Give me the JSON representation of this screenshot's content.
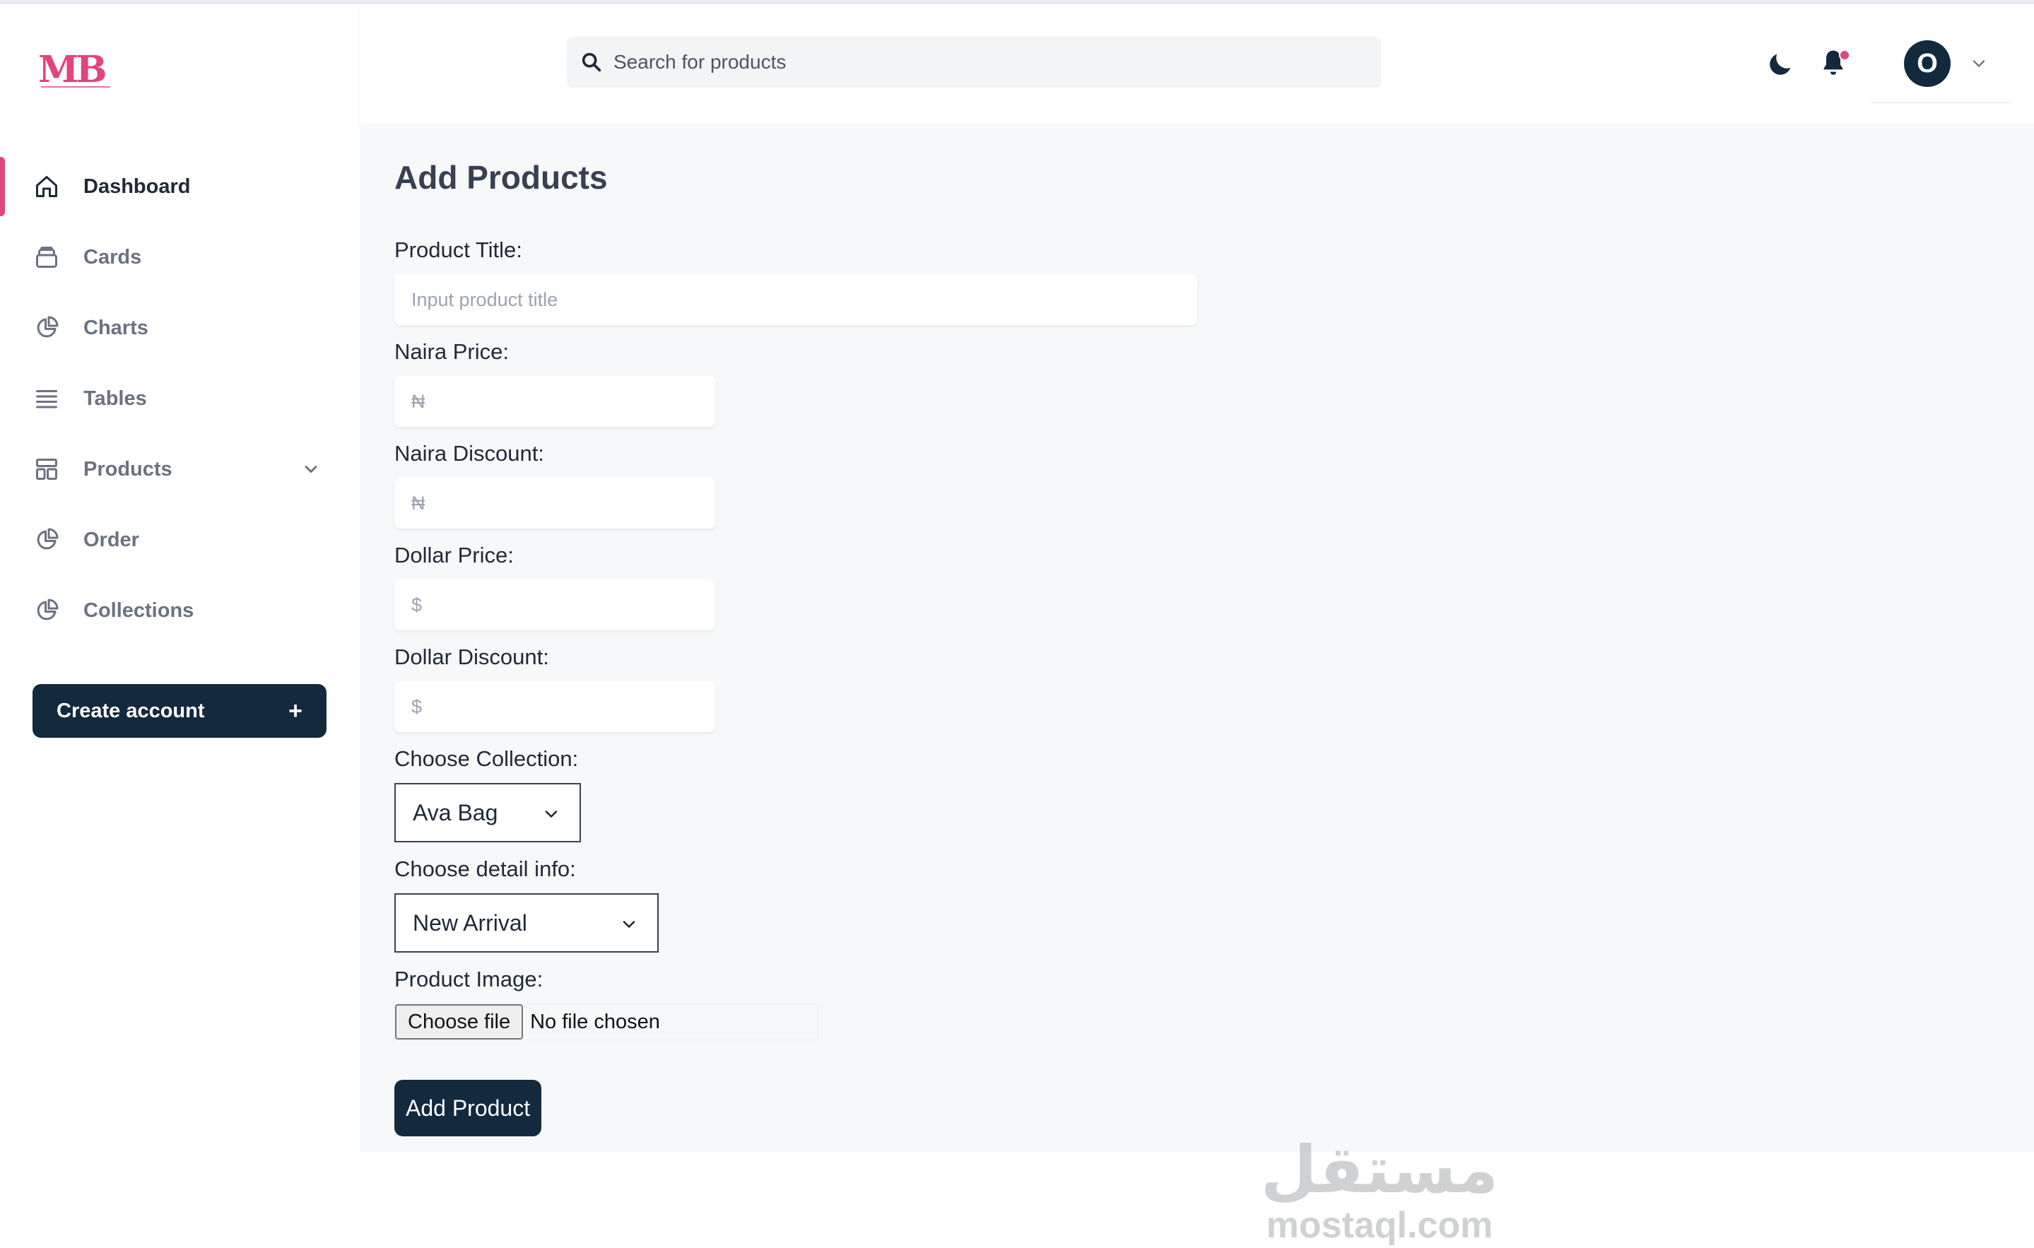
{
  "brand": {
    "logo_text": "MB",
    "accent_color": "#e0457b",
    "dark_color": "#13293d"
  },
  "search": {
    "placeholder": "Search for products"
  },
  "header": {
    "avatar_initial": "O"
  },
  "sidebar": {
    "items": [
      {
        "label": "Dashboard",
        "icon": "home-icon",
        "active": true
      },
      {
        "label": "Cards",
        "icon": "card-stack-icon"
      },
      {
        "label": "Charts",
        "icon": "pie-chart-icon"
      },
      {
        "label": "Tables",
        "icon": "list-icon"
      },
      {
        "label": "Products",
        "icon": "layout-icon",
        "has_submenu": true
      },
      {
        "label": "Order",
        "icon": "pie-chart-icon"
      },
      {
        "label": "Collections",
        "icon": "pie-chart-icon"
      }
    ],
    "create_account_label": "Create account",
    "create_account_icon": "+"
  },
  "form": {
    "title": "Add Products",
    "product_title_label": "Product Title:",
    "product_title_placeholder": "Input product title",
    "naira_price_label": "Naira Price:",
    "naira_price_placeholder": "₦",
    "naira_discount_label": "Naira Discount:",
    "naira_discount_placeholder": "₦",
    "dollar_price_label": "Dollar Price:",
    "dollar_price_placeholder": "$",
    "dollar_discount_label": "Dollar Discount:",
    "dollar_discount_placeholder": "$",
    "collection_label": "Choose Collection:",
    "collection_value": "Ava Bag",
    "detail_label": "Choose detail info:",
    "detail_value": "New Arrival",
    "image_label": "Product Image:",
    "file_button_label": "Choose file",
    "file_status": "No file chosen",
    "submit_label": "Add Product"
  },
  "watermark": {
    "arabic": "مستقل",
    "latin": "mostaql.com"
  }
}
